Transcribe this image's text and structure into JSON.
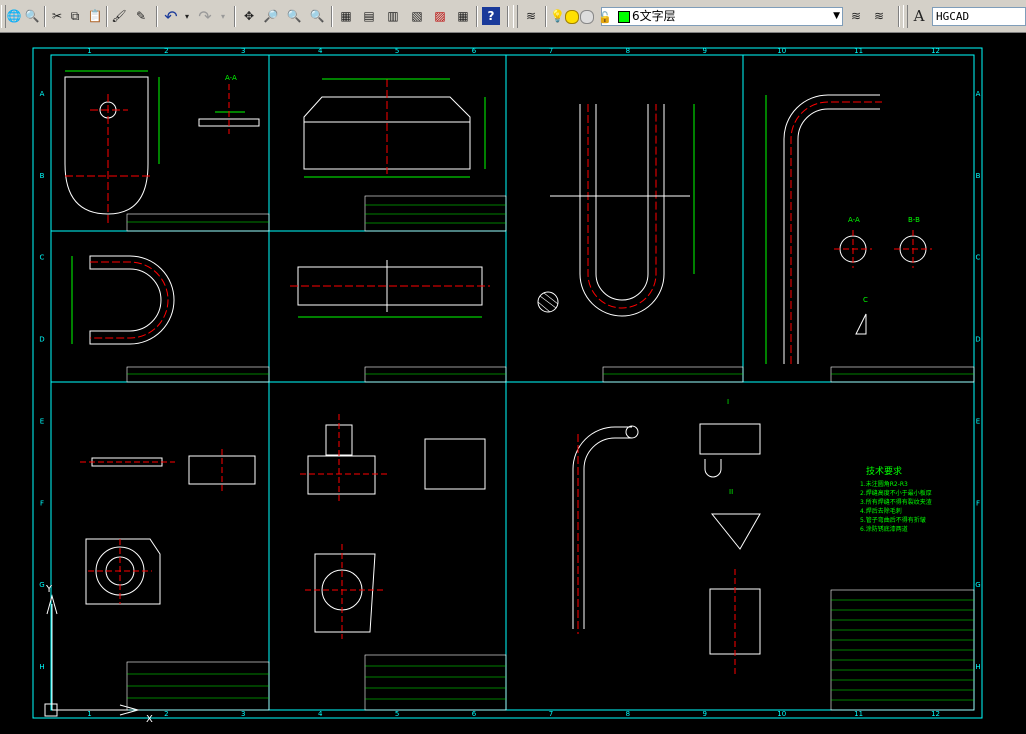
{
  "toolbar": {
    "layer_name": "6文字层",
    "font_name": "HGCAD"
  },
  "colors": {
    "frame": "#00ffff",
    "part": "#ffffff",
    "centerline": "#ff0000",
    "dimension": "#00ff00",
    "title_block": "#00ffff",
    "layer_swatch": "#00ff00",
    "background": "#000000"
  },
  "drawing": {
    "grid_columns": [
      "1",
      "2",
      "3",
      "4",
      "5",
      "6",
      "7",
      "8",
      "9",
      "10",
      "11",
      "12"
    ],
    "grid_rows": [
      "A",
      "B",
      "C",
      "D",
      "E",
      "F",
      "G",
      "H"
    ],
    "tech_notes_title": "技术要求",
    "tech_notes_lines": [
      "1.未注圆角R2-R3",
      "2.焊缝高度不小于最小板厚",
      "3.所有焊缝不得有裂纹夹渣",
      "4.焊后去除毛刺",
      "5.管子弯曲后不得有折皱",
      "6.涂防锈底漆两道"
    ],
    "section_a": "A-A",
    "section_b": "B-B",
    "section_c": "C",
    "section_i": "I",
    "section_ii": "II",
    "ucs_label_x": "X",
    "ucs_label_y": "Y"
  }
}
